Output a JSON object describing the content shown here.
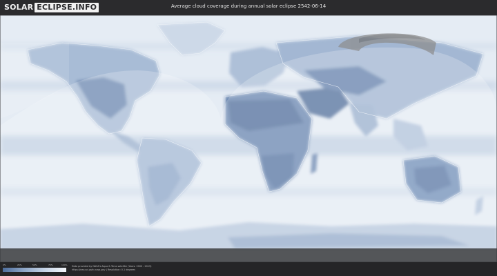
{
  "header": {
    "logo_solar": "SOLAR",
    "logo_eclipse": "ECLIPSE.INFO",
    "title": "Average cloud coverage during annual solar eclipse 2542-06-14"
  },
  "legend": {
    "labels": [
      "0%",
      "25%",
      "50%",
      "75%",
      "100%"
    ],
    "colors": [
      "#4d6d9c",
      "#8ea6c7",
      "#c6d4e6",
      "#f4f7fb"
    ]
  },
  "credit": {
    "line1": "Data provided by NASA's Aqua & Terra satellite (Years: 2000 - 2019)",
    "line2": "https://neo.sci.gsfc.nasa.gov | Resolution: 0.1 degrees"
  },
  "colors": {
    "ocean_cloud": "#e6edf5",
    "clear_land": "#5f7ca8",
    "partly_cloudy": "#a9bdd6",
    "eclipse_path": "#8b8b8b",
    "background": "#2b2b2d"
  }
}
